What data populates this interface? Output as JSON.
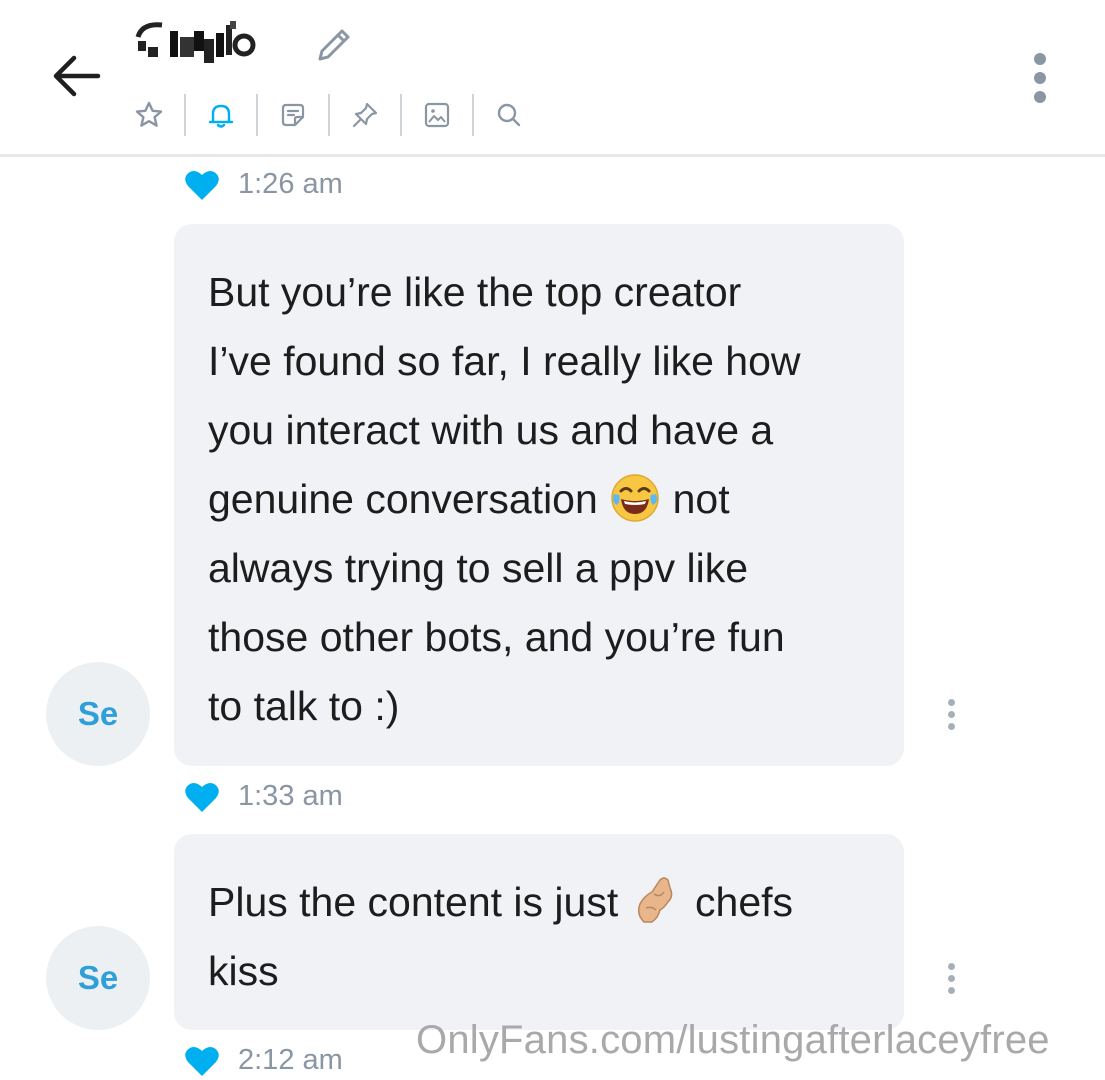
{
  "header": {
    "title": "",
    "toolbar": [
      {
        "name": "star-icon"
      },
      {
        "name": "bell-icon"
      },
      {
        "name": "note-icon"
      },
      {
        "name": "pin-icon"
      },
      {
        "name": "image-icon"
      },
      {
        "name": "search-icon"
      }
    ]
  },
  "messages": [
    {
      "time": "1:26 am"
    },
    {
      "avatar": "Se",
      "lines": [
        "But you’re like the top creator",
        "I’ve found so far, I really like how",
        "you interact with us and have a",
        "genuine conversation",
        "not",
        "always trying to sell a ppv like",
        "those other bots, and you’re fun",
        "to talk to :)"
      ],
      "emoji": "face-with-tears-of-joy",
      "time": "1:33 am"
    },
    {
      "avatar": "Se",
      "lines": [
        "Plus the content is just",
        "chefs",
        "kiss"
      ],
      "emoji": "pinched-fingers",
      "time": "2:12 am"
    }
  ],
  "watermark": "OnlyFans.com/lustingafterlaceyfree",
  "colors": {
    "accent": "#00aff0",
    "bubble": "#f0f2f5",
    "muted": "#8a96a3",
    "avatar_text": "#2e9fd8"
  }
}
